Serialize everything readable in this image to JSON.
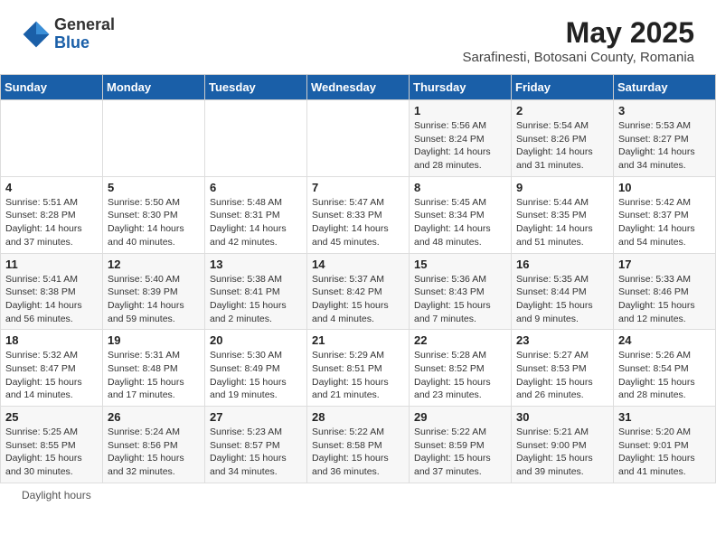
{
  "logo": {
    "general": "General",
    "blue": "Blue"
  },
  "header": {
    "title": "May 2025",
    "subtitle": "Sarafinesti, Botosani County, Romania"
  },
  "days_of_week": [
    "Sunday",
    "Monday",
    "Tuesday",
    "Wednesday",
    "Thursday",
    "Friday",
    "Saturday"
  ],
  "weeks": [
    [
      {
        "day": "",
        "info": ""
      },
      {
        "day": "",
        "info": ""
      },
      {
        "day": "",
        "info": ""
      },
      {
        "day": "",
        "info": ""
      },
      {
        "day": "1",
        "info": "Sunrise: 5:56 AM\nSunset: 8:24 PM\nDaylight: 14 hours and 28 minutes."
      },
      {
        "day": "2",
        "info": "Sunrise: 5:54 AM\nSunset: 8:26 PM\nDaylight: 14 hours and 31 minutes."
      },
      {
        "day": "3",
        "info": "Sunrise: 5:53 AM\nSunset: 8:27 PM\nDaylight: 14 hours and 34 minutes."
      }
    ],
    [
      {
        "day": "4",
        "info": "Sunrise: 5:51 AM\nSunset: 8:28 PM\nDaylight: 14 hours and 37 minutes."
      },
      {
        "day": "5",
        "info": "Sunrise: 5:50 AM\nSunset: 8:30 PM\nDaylight: 14 hours and 40 minutes."
      },
      {
        "day": "6",
        "info": "Sunrise: 5:48 AM\nSunset: 8:31 PM\nDaylight: 14 hours and 42 minutes."
      },
      {
        "day": "7",
        "info": "Sunrise: 5:47 AM\nSunset: 8:33 PM\nDaylight: 14 hours and 45 minutes."
      },
      {
        "day": "8",
        "info": "Sunrise: 5:45 AM\nSunset: 8:34 PM\nDaylight: 14 hours and 48 minutes."
      },
      {
        "day": "9",
        "info": "Sunrise: 5:44 AM\nSunset: 8:35 PM\nDaylight: 14 hours and 51 minutes."
      },
      {
        "day": "10",
        "info": "Sunrise: 5:42 AM\nSunset: 8:37 PM\nDaylight: 14 hours and 54 minutes."
      }
    ],
    [
      {
        "day": "11",
        "info": "Sunrise: 5:41 AM\nSunset: 8:38 PM\nDaylight: 14 hours and 56 minutes."
      },
      {
        "day": "12",
        "info": "Sunrise: 5:40 AM\nSunset: 8:39 PM\nDaylight: 14 hours and 59 minutes."
      },
      {
        "day": "13",
        "info": "Sunrise: 5:38 AM\nSunset: 8:41 PM\nDaylight: 15 hours and 2 minutes."
      },
      {
        "day": "14",
        "info": "Sunrise: 5:37 AM\nSunset: 8:42 PM\nDaylight: 15 hours and 4 minutes."
      },
      {
        "day": "15",
        "info": "Sunrise: 5:36 AM\nSunset: 8:43 PM\nDaylight: 15 hours and 7 minutes."
      },
      {
        "day": "16",
        "info": "Sunrise: 5:35 AM\nSunset: 8:44 PM\nDaylight: 15 hours and 9 minutes."
      },
      {
        "day": "17",
        "info": "Sunrise: 5:33 AM\nSunset: 8:46 PM\nDaylight: 15 hours and 12 minutes."
      }
    ],
    [
      {
        "day": "18",
        "info": "Sunrise: 5:32 AM\nSunset: 8:47 PM\nDaylight: 15 hours and 14 minutes."
      },
      {
        "day": "19",
        "info": "Sunrise: 5:31 AM\nSunset: 8:48 PM\nDaylight: 15 hours and 17 minutes."
      },
      {
        "day": "20",
        "info": "Sunrise: 5:30 AM\nSunset: 8:49 PM\nDaylight: 15 hours and 19 minutes."
      },
      {
        "day": "21",
        "info": "Sunrise: 5:29 AM\nSunset: 8:51 PM\nDaylight: 15 hours and 21 minutes."
      },
      {
        "day": "22",
        "info": "Sunrise: 5:28 AM\nSunset: 8:52 PM\nDaylight: 15 hours and 23 minutes."
      },
      {
        "day": "23",
        "info": "Sunrise: 5:27 AM\nSunset: 8:53 PM\nDaylight: 15 hours and 26 minutes."
      },
      {
        "day": "24",
        "info": "Sunrise: 5:26 AM\nSunset: 8:54 PM\nDaylight: 15 hours and 28 minutes."
      }
    ],
    [
      {
        "day": "25",
        "info": "Sunrise: 5:25 AM\nSunset: 8:55 PM\nDaylight: 15 hours and 30 minutes."
      },
      {
        "day": "26",
        "info": "Sunrise: 5:24 AM\nSunset: 8:56 PM\nDaylight: 15 hours and 32 minutes."
      },
      {
        "day": "27",
        "info": "Sunrise: 5:23 AM\nSunset: 8:57 PM\nDaylight: 15 hours and 34 minutes."
      },
      {
        "day": "28",
        "info": "Sunrise: 5:22 AM\nSunset: 8:58 PM\nDaylight: 15 hours and 36 minutes."
      },
      {
        "day": "29",
        "info": "Sunrise: 5:22 AM\nSunset: 8:59 PM\nDaylight: 15 hours and 37 minutes."
      },
      {
        "day": "30",
        "info": "Sunrise: 5:21 AM\nSunset: 9:00 PM\nDaylight: 15 hours and 39 minutes."
      },
      {
        "day": "31",
        "info": "Sunrise: 5:20 AM\nSunset: 9:01 PM\nDaylight: 15 hours and 41 minutes."
      }
    ]
  ],
  "footer": {
    "daylight_hours": "Daylight hours"
  }
}
